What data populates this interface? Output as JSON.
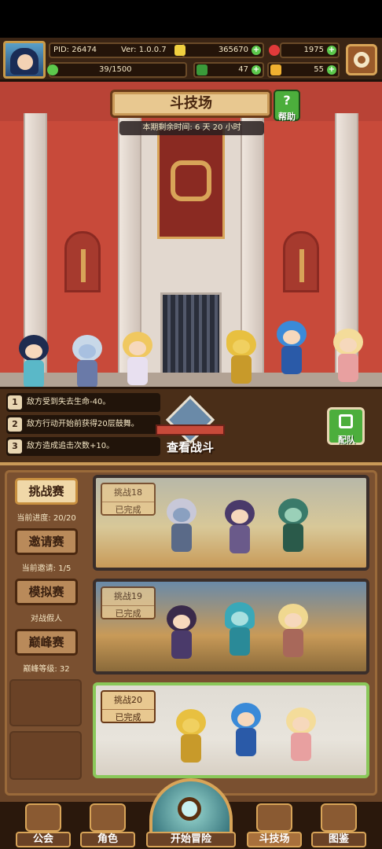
{
  "header": {
    "pid": "PID: 26474",
    "version": "Ver: 1.0.0.7",
    "gold": "365670",
    "gems": "1975",
    "exp": "39/1500",
    "clover": "47",
    "key": "55"
  },
  "arena": {
    "title": "斗技场",
    "help_label": "帮助",
    "help_glyph": "?",
    "timer": "本期剩余时间: 6 天 20 小时"
  },
  "buffs": [
    {
      "num": "1",
      "text": "敌方受到失去生命-40。"
    },
    {
      "num": "2",
      "text": "敌方行动开始前获得20层鼓舞。"
    },
    {
      "num": "3",
      "text": "敌方造成追击次数+10。"
    }
  ],
  "actions": {
    "view_battle": "查看战斗",
    "team": "配队"
  },
  "modes": [
    {
      "label": "挑战赛",
      "sub": "当前进度: 20/20",
      "active": true
    },
    {
      "label": "邀请赛",
      "sub": "当前邀请: 1/5",
      "active": false
    },
    {
      "label": "模拟赛",
      "sub": "对战假人",
      "active": false
    },
    {
      "label": "巅峰赛",
      "sub": "巅峰等级: 32",
      "active": false
    }
  ],
  "challenges": [
    {
      "title": "挑战18",
      "status": "已完成"
    },
    {
      "title": "挑战19",
      "status": "已完成"
    },
    {
      "title": "挑战20",
      "status": "已完成"
    }
  ],
  "nav": [
    {
      "label": "公会",
      "icon": "guild-icon"
    },
    {
      "label": "角色",
      "icon": "character-icon"
    },
    {
      "label": "开始冒险",
      "icon": "magnifier-icon"
    },
    {
      "label": "斗技场",
      "icon": "crossed-swords-icon"
    },
    {
      "label": "图鉴",
      "icon": "book-icon"
    }
  ],
  "colors": {
    "accent_gold": "#d8a458",
    "panel_brown": "#6b4528",
    "green": "#4cae3c",
    "wall_red": "#c84a3a"
  }
}
